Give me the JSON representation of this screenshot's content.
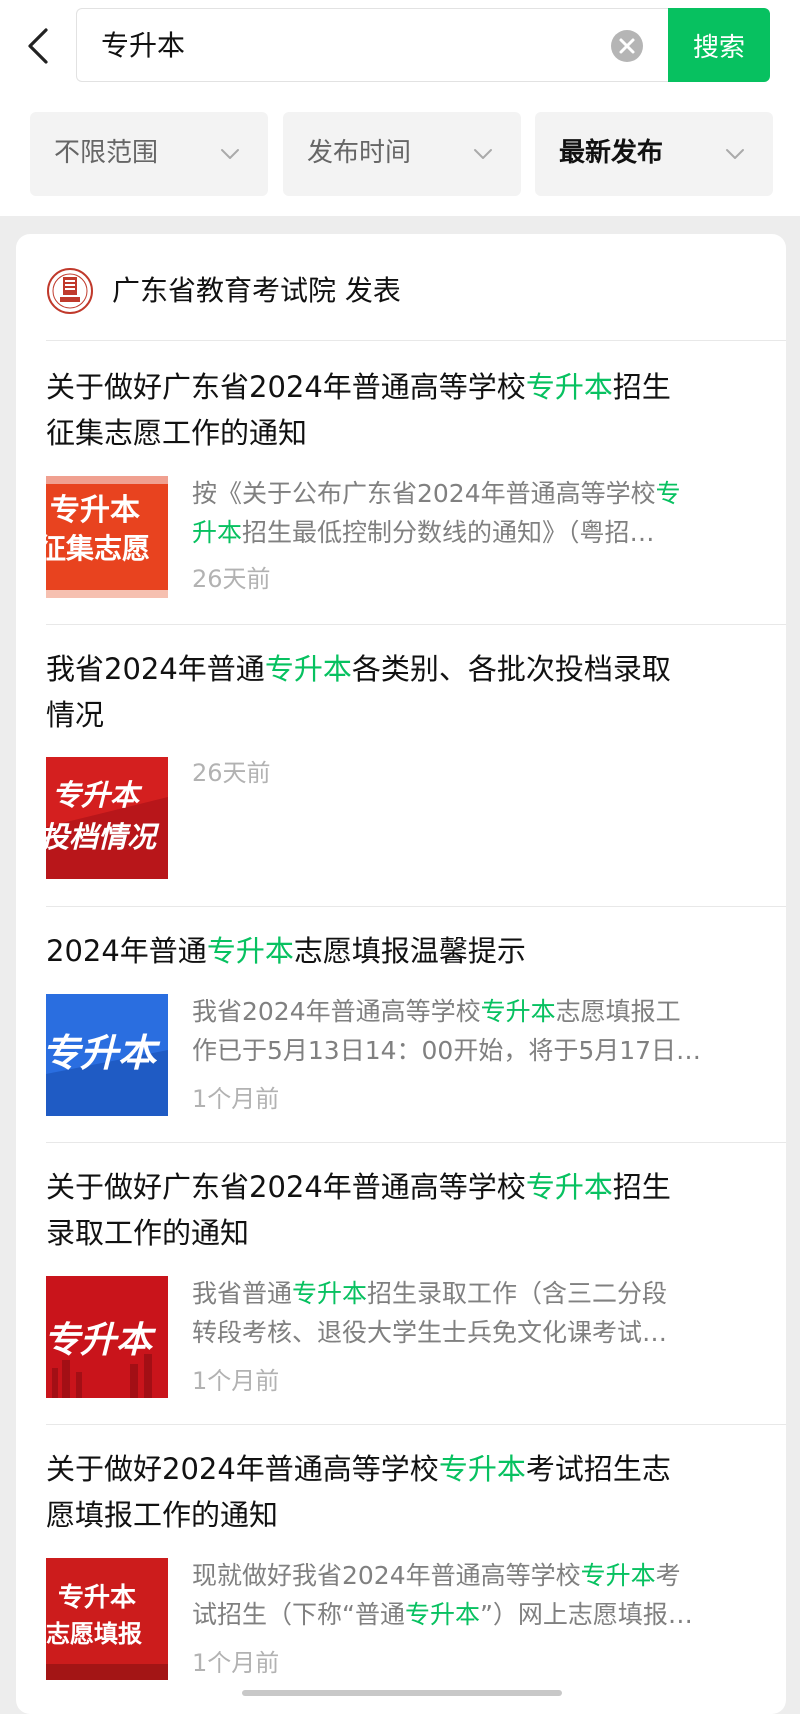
{
  "search": {
    "query": "专升本",
    "button_label": "搜索"
  },
  "filters": [
    {
      "label": "不限范围"
    },
    {
      "label": "发布时间"
    },
    {
      "label": "最新发布"
    }
  ],
  "publisher": {
    "name": "广东省教育考试院 发表"
  },
  "thumb_text": {
    "t1_line1": "专升本",
    "t1_line2": "征集志愿",
    "t2_line1": "专升本",
    "t2_line2": "投档情况",
    "t3_line1": "专升本",
    "t4_line1": "专升本",
    "t5_line1": "专升本",
    "t5_line2": "志愿填报"
  },
  "articles": [
    {
      "title_line1_a": "关于做好广东省2024年普通高等学校",
      "title_line1_hl": "专升本",
      "title_line1_b": "招生",
      "title_line2": "征集志愿工作的通知",
      "snippet_line1_a": "按《关于公布广东省2024年普通高等学校",
      "snippet_line1_hl": "专",
      "snippet_line2_hl": "升本",
      "snippet_line2_b": "招生最低控制分数线的通知》（粤招…",
      "time": "26天前"
    },
    {
      "title_line1_a": "我省2024年普通",
      "title_line1_hl": "专升本",
      "title_line1_b": "各类别、各批次投档录取",
      "title_line2": "情况",
      "time": "26天前"
    },
    {
      "title_line1_a": "2024年普通",
      "title_line1_hl": "专升本",
      "title_line1_b": "志愿填报温馨提示",
      "snippet_line1_a": "我省2024年普通高等学校",
      "snippet_line1_hl": "专升本",
      "snippet_line1_b": "志愿填报工",
      "snippet_line2": "作已于5月13日14：00开始，将于5月17日…",
      "time": "1个月前"
    },
    {
      "title_line1_a": "关于做好广东省2024年普通高等学校",
      "title_line1_hl": "专升本",
      "title_line1_b": "招生",
      "title_line2": "录取工作的通知",
      "snippet_line1_a": "我省普通",
      "snippet_line1_hl": "专升本",
      "snippet_line1_b": "招生录取工作（含三二分段",
      "snippet_line2": "转段考核、退役大学生士兵免文化课考试…",
      "time": "1个月前"
    },
    {
      "title_line1_a": "关于做好2024年普通高等学校",
      "title_line1_hl": "专升本",
      "title_line1_b": "考试招生志",
      "title_line2": "愿填报工作的通知",
      "snippet_line1_a": "现就做好我省2024年普通高等学校",
      "snippet_line1_hl": "专升本",
      "snippet_line1_b": "考",
      "snippet_line2_a": "试招生（下称“普通",
      "snippet_line2_hl": "专升本",
      "snippet_line2_b": "”）网上志愿填报…",
      "time": "1个月前"
    }
  ]
}
